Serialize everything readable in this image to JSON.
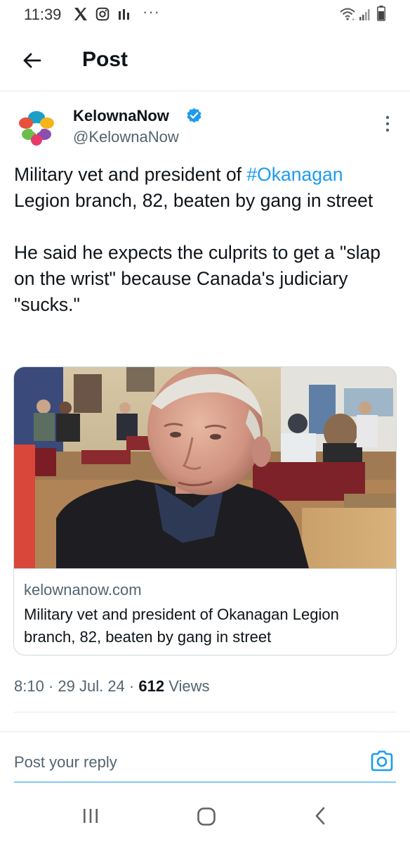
{
  "status_bar": {
    "time": "11:39",
    "icons": [
      "x-icon",
      "instagram-icon",
      "signal-app-icon",
      "more-dots-icon",
      "wifi-icon",
      "cell-signal-icon",
      "battery-icon"
    ],
    "dots": "···"
  },
  "header": {
    "back_icon": "arrow-left-icon",
    "title": "Post"
  },
  "author": {
    "name": "KelownaNow",
    "handle": "@KelownaNow",
    "verified": true,
    "more_icon": "more-vertical-icon"
  },
  "tweet": {
    "line1_prefix": "Military vet and president of ",
    "hashtag": "#Okanagan",
    "line1_suffix": " Legion branch, 82, beaten by gang in street",
    "paragraph2": "He said he expects the culprits to get a \"slap on the wrist\" because Canada's judiciary \"sucks.\""
  },
  "card": {
    "domain": "kelownanow.com",
    "title": "Military vet and president of Okanagan Legion branch, 82, beaten by gang in street"
  },
  "meta": {
    "time": "8:10",
    "sep1": " · ",
    "date": "29 Jul. 24",
    "sep2": " · ",
    "views_count": "612",
    "views_label": " Views"
  },
  "reply": {
    "placeholder": "Post your reply",
    "camera_icon": "camera-icon"
  },
  "nav_bar": {
    "icons": [
      "recents-icon",
      "home-icon",
      "back-icon"
    ]
  },
  "colors": {
    "accent": "#1d9bf0",
    "text_primary": "#0f1419",
    "text_secondary": "#536471",
    "border": "#cfd9de"
  }
}
